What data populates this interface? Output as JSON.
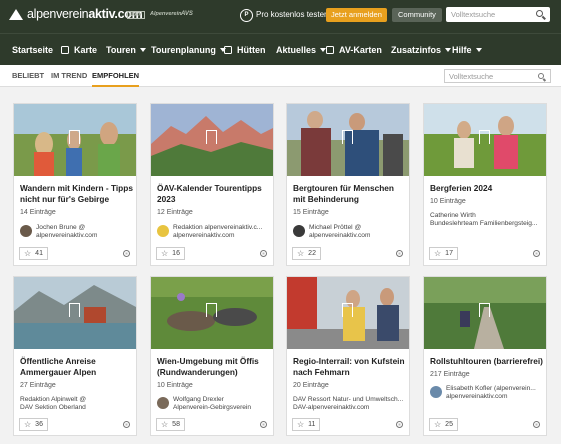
{
  "header": {
    "logo_light": "alpenverein",
    "logo_bold": "aktiv.com",
    "partners": [
      "DAV",
      "Alpenverein",
      "AVS"
    ],
    "free_label": "Pro kostenlos testen",
    "register_label": "Jetzt anmelden",
    "community_label": "Community",
    "search_placeholder": "Volltextsuche"
  },
  "nav": {
    "items": [
      {
        "label": "Startseite"
      },
      {
        "label": "Karte"
      },
      {
        "label": "Touren"
      },
      {
        "label": "Tourenplanung"
      },
      {
        "label": "Hütten"
      },
      {
        "label": "Aktuelles"
      },
      {
        "label": "AV-Karten"
      },
      {
        "label": "Zusatzinfos"
      },
      {
        "label": "Hilfe"
      }
    ]
  },
  "tabs": {
    "items": [
      {
        "label": "Beliebt"
      },
      {
        "label": "Im Trend"
      },
      {
        "label": "Empfohlen"
      }
    ],
    "search_placeholder": "Volltextsuche"
  },
  "cards": [
    {
      "title": "Wandern mit Kindern - Tipps nicht nur für's Gebirge",
      "count": "14 Einträge",
      "author1": "Jochen Brune @",
      "author2": "alpenvereinaktiv.com",
      "likes": "41"
    },
    {
      "title": "ÖAV-Kalender Tourentipps 2023",
      "count": "12 Einträge",
      "author1": "Redaktion alpenvereinaktiv.c...",
      "author2": "alpenvereinaktiv.com",
      "likes": "16"
    },
    {
      "title": "Bergtouren für Menschen mit Behinderung",
      "count": "15 Einträge",
      "author1": "Michael Pröttel @",
      "author2": "alpenvereinaktiv.com",
      "likes": "22"
    },
    {
      "title": "Bergferien 2024",
      "count": "10 Einträge",
      "author1": "Catherine Wirth",
      "author2": "Bundeslehrteam Familienbergsteig...",
      "likes": "17"
    },
    {
      "title": "Öffentliche Anreise Ammergauer Alpen",
      "count": "27 Einträge",
      "author1": "Redaktion Alpinwelt @",
      "author2": "DAV Sektion Oberland",
      "likes": "36"
    },
    {
      "title": "Wien-Umgebung mit Öffis (Rundwanderungen)",
      "count": "10 Einträge",
      "author1": "Wolfgang Drexler",
      "author2": "Alpenverein-Gebirgsverein",
      "likes": "58"
    },
    {
      "title": "Regio-Interrail: von Kufstein nach Fehmarn",
      "count": "20 Einträge",
      "author1": "DAV Ressort Natur- und Umweltsch...",
      "author2": "DAV-alpenvereinaktiv.com",
      "likes": "11"
    },
    {
      "title": "Rollstuhltouren (barrierefrei)",
      "count": "217 Einträge",
      "author1": "Elisabeth Kofler (alpenverein...",
      "author2": "alpenvereinaktiv.com",
      "likes": "25"
    }
  ]
}
